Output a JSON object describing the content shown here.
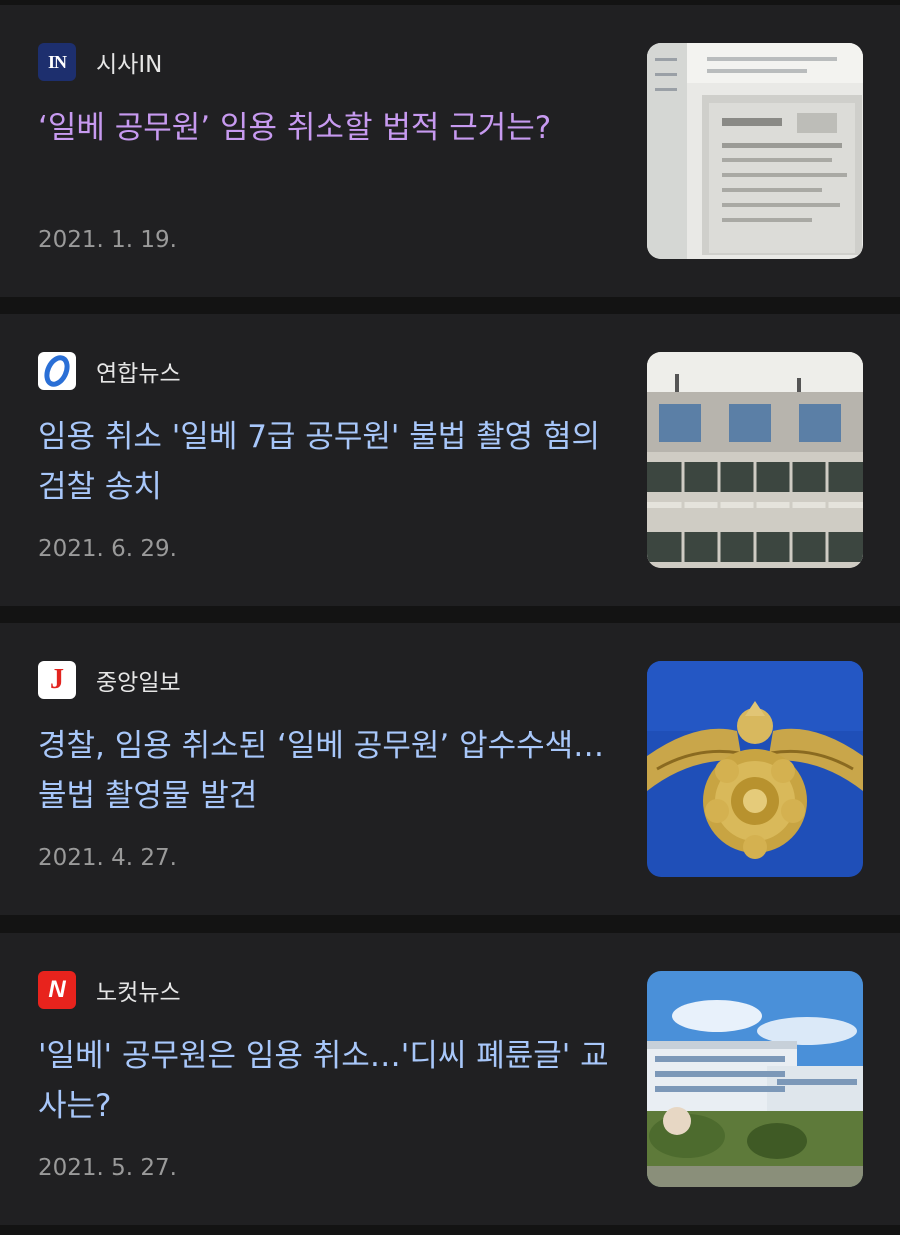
{
  "articles": [
    {
      "source": "시사IN",
      "logo_text": "IN",
      "headline": "‘일베 공무원’ 임용 취소할 법적 근거는?",
      "date": "2021. 1. 19.",
      "visited": true,
      "thumbnail": "document-photo"
    },
    {
      "source": "연합뉴스",
      "logo_text": "",
      "headline": "임용 취소 '일베 7급 공무원' 불법 촬영 혐의 검찰 송치",
      "date": "2021. 6. 29.",
      "visited": false,
      "thumbnail": "police-building-sign"
    },
    {
      "source": "중앙일보",
      "logo_text": "J",
      "headline": "경찰, 임용 취소된 ‘일베 공무원’ 압수수색…불법 촬영물 발견",
      "date": "2021. 4. 27.",
      "visited": false,
      "thumbnail": "police-emblem"
    },
    {
      "source": "노컷뉴스",
      "logo_text": "N",
      "headline": "'일베' 공무원은 임용 취소…'디씨 폐륜글' 교사는?",
      "date": "2021. 5. 27.",
      "visited": false,
      "thumbnail": "government-building"
    }
  ],
  "colors": {
    "background": "#131313",
    "card": "#202022",
    "link": "#a8c7fa",
    "visited_link": "#c79af0",
    "date": "#9a9a9a"
  }
}
